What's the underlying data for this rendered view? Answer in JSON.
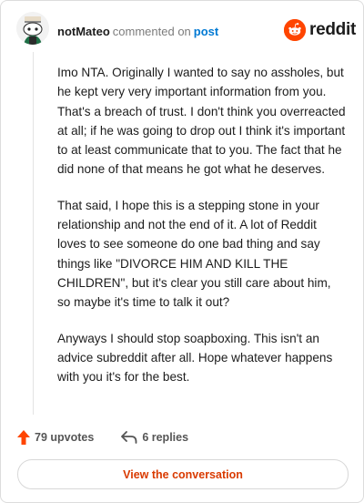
{
  "header": {
    "username": "notMateo",
    "action_text": "commented on",
    "post_link": "post",
    "brand": "reddit"
  },
  "comment": {
    "paragraphs": [
      "Imo NTA. Originally I wanted to say no assholes, but he kept very very important information from you. That's a breach of trust. I don't think you overreacted at all; if he was going to drop out I think it's important to at least communicate that to you. The fact that he did none of that means he got what he deserves.",
      "That said, I hope this is a stepping stone in your relationship and not the end of it. A lot of Reddit loves to see someone do one bad thing and say things like \"DIVORCE HIM AND KILL THE CHILDREN\", but it's clear you still care about him, so maybe it's time to talk it out?",
      "Anyways I should stop soapboxing. This isn't an advice subreddit after all. Hope whatever happens with you it's for the best."
    ]
  },
  "footer": {
    "upvotes": "79 upvotes",
    "replies": "6 replies",
    "view_button": "View the conversation"
  },
  "colors": {
    "upvote": "#ff4500",
    "link": "#0079d3",
    "button_text": "#d93a00"
  }
}
